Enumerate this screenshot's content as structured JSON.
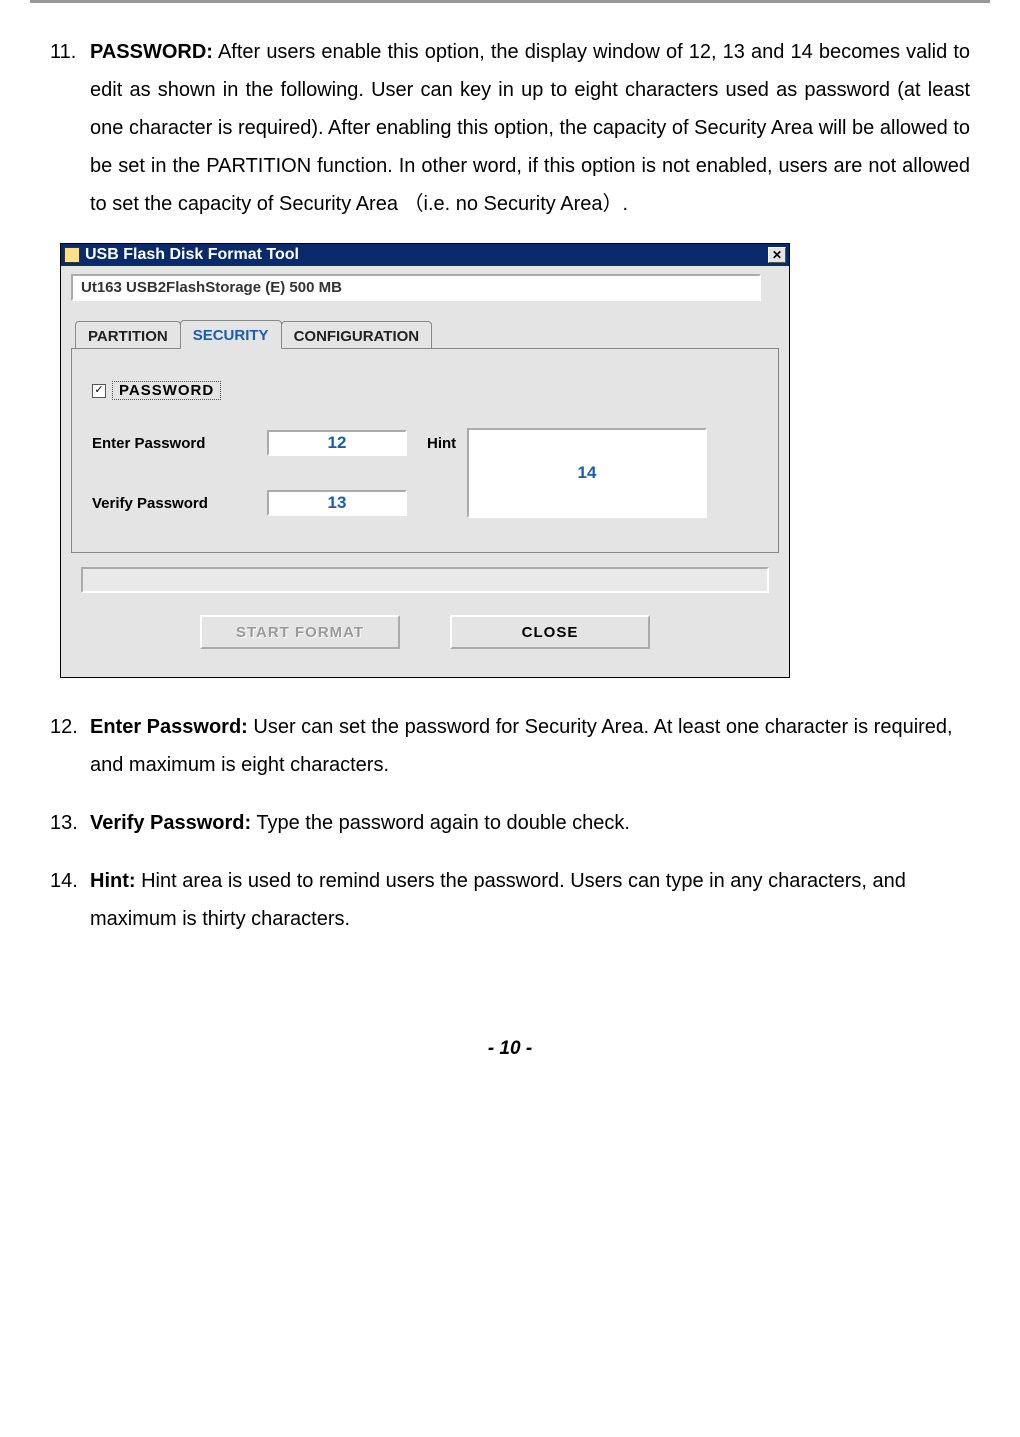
{
  "items": {
    "11": {
      "num": "11.",
      "label": "PASSWORD:",
      "text": " After users enable this option, the display window of 12, 13 and 14 becomes valid to edit as shown in the following. User can key in up to eight characters used as password (at least one character is required). After enabling this option, the capacity of Security Area will be allowed to be set in the PARTITION function. In other word, if this option is not enabled, users are not allowed to set the capacity of Security Area （i.e. no Security Area）."
    },
    "12": {
      "num": "12.",
      "label": "Enter Password:",
      "text": " User can set the password for Security Area. At least one character is required, and maximum is eight characters."
    },
    "13": {
      "num": "13.",
      "label": "Verify Password:",
      "text": " Type the password again to double check."
    },
    "14": {
      "num": "14.",
      "label": "Hint:",
      "text": " Hint area is used to remind users the password. Users can type in any characters, and maximum is thirty characters."
    }
  },
  "dialog": {
    "title": "USB Flash Disk Format Tool",
    "dropdown": "Ut163    USB2FlashStorage (E)  500 MB",
    "tabs": {
      "partition": "PARTITION",
      "security": "SECURITY",
      "configuration": "CONFIGURATION"
    },
    "checkbox_label": "PASSWORD",
    "enter_label": "Enter Password",
    "verify_label": "Verify Password",
    "hint_label": "Hint",
    "enter_value": "12",
    "verify_value": "13",
    "hint_value": "14",
    "start_btn": "START FORMAT",
    "close_btn": "CLOSE"
  },
  "footer": "- 10 -"
}
